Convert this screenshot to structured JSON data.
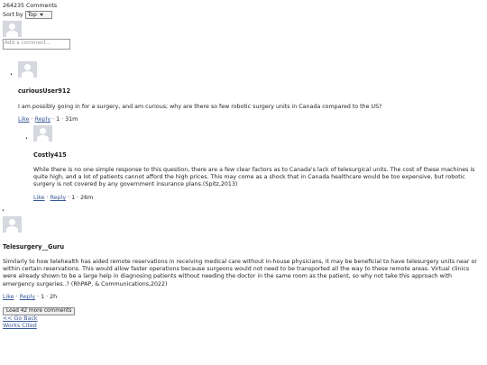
{
  "header": {
    "comment_count": "264235 Comments",
    "sort_label": "Sort by",
    "sort_value": "Top"
  },
  "composer": {
    "placeholder": "Add a comment..."
  },
  "comments": [
    {
      "author": "curiousUser912",
      "text": "I am possibly going in for a surgery, and am curious; why are there so few robotic surgery units in Canada compared to the US?",
      "like": "Like",
      "reply": "Reply",
      "likes": "1",
      "time": "31m"
    },
    {
      "author": "Costly415",
      "text": "While there is no one simple response to this question, there are a few clear factors as to Canada's lack of telesurgical units. The cost of these machines is quite high, and a lot of patients cannot afford the high prices. This may come as a shock that in Canada healthcare would be too expensive, but robotic surgery is not covered by any government insurance plans.(Spitz,2013)",
      "like": "Like",
      "reply": "Reply",
      "likes": "1",
      "time": "26m"
    },
    {
      "author": "Telesurgery__Guru",
      "text": "Similarly to how telehealth has aided remote reservations in receiving medical care without in-house physicians, it may be beneficial to have telesurgery units near or within certain reservations. This would allow faster operations because surgeons would not need to be transported all the way to these remote areas. Virtual clinics were already shown to be a large help in diagnosing patients without needing the doctor in the same room as the patient, so why not take this approach with emergency surgeries..? (RhPAP, & Communications,2022)",
      "like": "Like",
      "reply": "Reply",
      "likes": "1",
      "time": "2h"
    }
  ],
  "separator": "·",
  "list_markers": [
    "•",
    "•",
    "•"
  ],
  "footer": {
    "load_more": "Load 42 more comments",
    "go_back": "<< Go Back",
    "works_cited": "Works Cited"
  },
  "icons": {
    "avatar": "default-user-avatar-icon",
    "dropdown": "chevron-down-icon"
  },
  "colors": {
    "link": "#385898",
    "avatar_bg": "#d5d8de"
  }
}
